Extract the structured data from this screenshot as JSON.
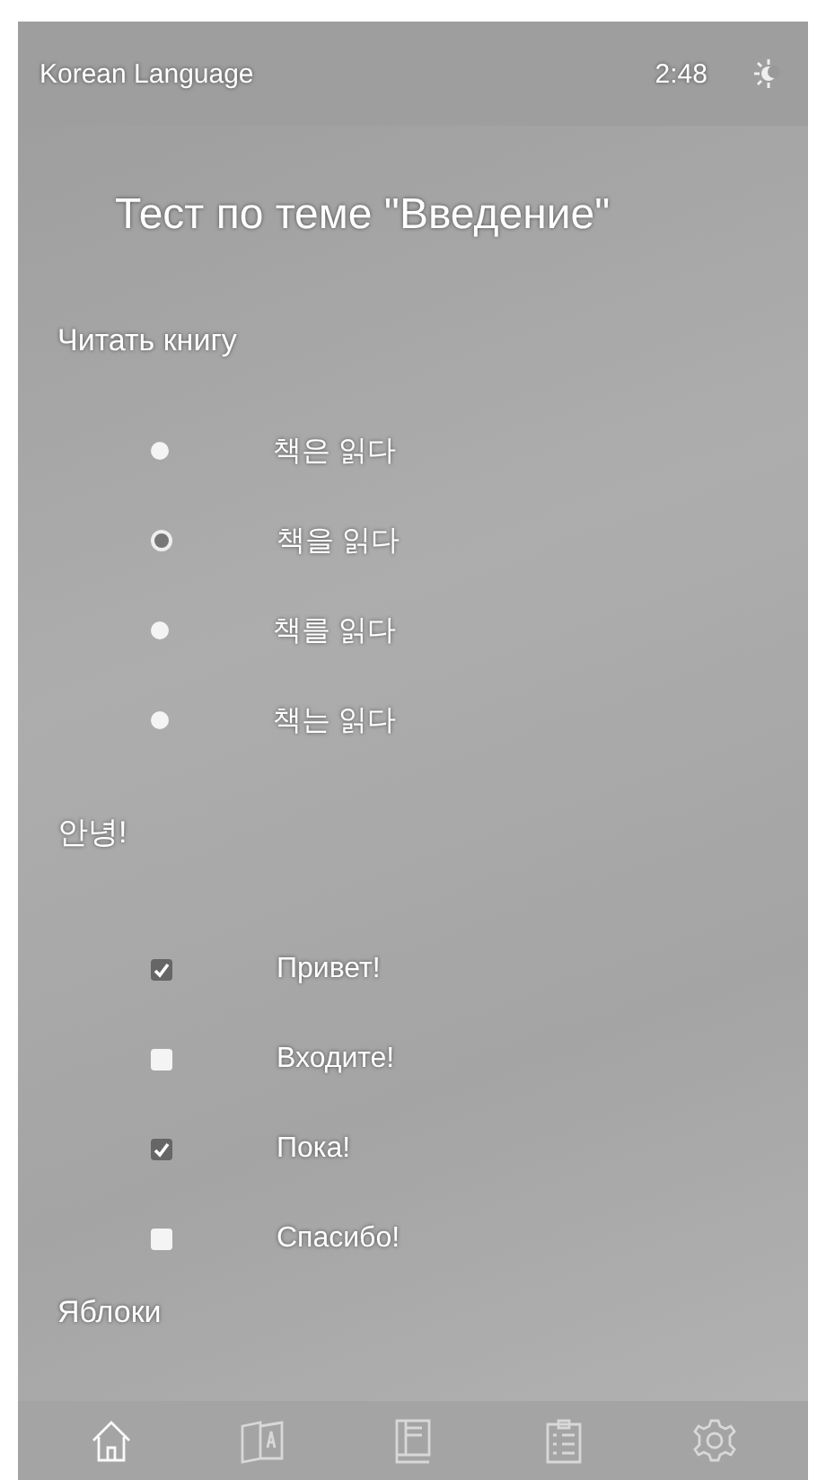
{
  "app_bar": {
    "title": "Korean Language",
    "time": "2:48"
  },
  "test_title": "Тест по теме \"Введение\"",
  "questions": [
    {
      "kind": "single",
      "prompt": "Читать книгу",
      "options": [
        {
          "label": "책은 읽다",
          "selected": false
        },
        {
          "label": "책을 읽다",
          "selected": true
        },
        {
          "label": "책를 읽다",
          "selected": false
        },
        {
          "label": "책는 읽다",
          "selected": false
        }
      ]
    },
    {
      "kind": "multiple",
      "prompt": "안녕!",
      "options": [
        {
          "label": "Привет!",
          "selected": true
        },
        {
          "label": "Входите!",
          "selected": false
        },
        {
          "label": "Пока!",
          "selected": true
        },
        {
          "label": "Спасибо!",
          "selected": false
        }
      ]
    },
    {
      "kind": "single",
      "prompt": "Яблоки"
    }
  ],
  "bottom_nav": [
    {
      "kind": "home",
      "selected": true
    },
    {
      "kind": "translate",
      "selected": false
    },
    {
      "kind": "book",
      "selected": false
    },
    {
      "kind": "checklist",
      "selected": false
    },
    {
      "kind": "settings",
      "selected": false
    }
  ]
}
